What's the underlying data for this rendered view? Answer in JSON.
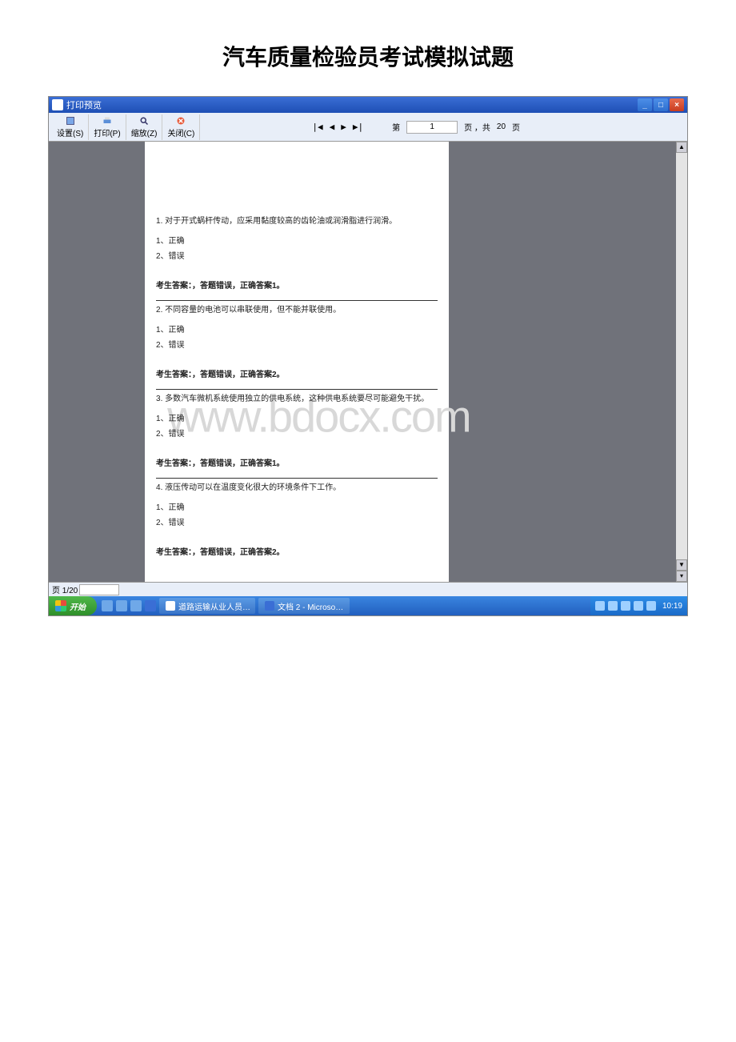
{
  "document": {
    "title": "汽车质量检验员考试模拟试题"
  },
  "window": {
    "title": "打印预览"
  },
  "toolbar": {
    "setup": "设置(S)",
    "print": "打印(P)",
    "zoom": "缩放(Z)",
    "close": "关闭(C)",
    "nav_first": "|◀",
    "nav_prev": "◀",
    "nav_next": "▶",
    "nav_last": "▶|",
    "page_label_prefix": "第",
    "page_value": "1",
    "page_label_mid": "页 ，共",
    "total_pages": "20",
    "page_label_suffix": "页"
  },
  "questions": [
    {
      "num": "1",
      "text": "对于开式蜗杆传动，应采用黏度较高的齿轮油或润滑脂进行润滑。",
      "opt1": "1、正确",
      "opt2": "2、错误",
      "answer": "考生答案：，答题错误，正确答案1。"
    },
    {
      "num": "2",
      "text": "不同容量的电池可以串联使用，但不能并联使用。",
      "opt1": "1、正确",
      "opt2": "2、错误",
      "answer": "考生答案：，答题错误，正确答案2。"
    },
    {
      "num": "3",
      "text": "多数汽车微机系统使用独立的供电系统，这种供电系统要尽可能避免干扰。",
      "opt1": "1、正确",
      "opt2": "2、错误",
      "answer": "考生答案：，答题错误，正确答案1。"
    },
    {
      "num": "4",
      "text": "液压传动可以在温度变化很大的环境条件下工作。",
      "opt1": "1、正确",
      "opt2": "2、错误",
      "answer": "考生答案：，答题错误，正确答案2。"
    }
  ],
  "statusbar": {
    "label": "页 1/20"
  },
  "taskbar": {
    "start": "开始",
    "task1": "道路运输从业人员…",
    "task2": "文档 2 - Microso…",
    "clock": "10:19"
  },
  "watermark": "www.bdocx.com"
}
